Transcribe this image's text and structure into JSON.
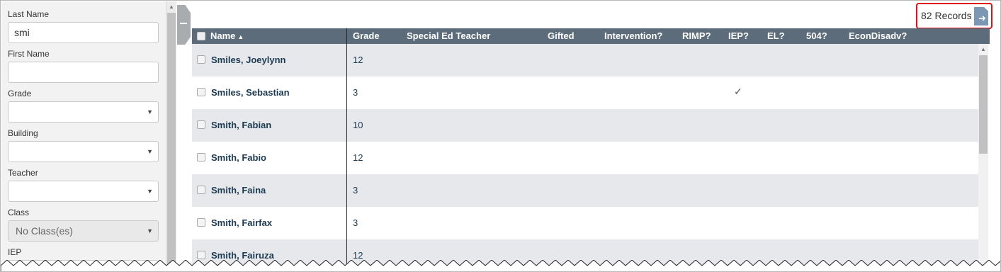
{
  "sidebar": {
    "last_name": {
      "label": "Last Name",
      "value": "smi"
    },
    "first_name": {
      "label": "First Name",
      "value": ""
    },
    "grade": {
      "label": "Grade",
      "value": ""
    },
    "building": {
      "label": "Building",
      "value": ""
    },
    "teacher": {
      "label": "Teacher",
      "value": ""
    },
    "class": {
      "label": "Class",
      "value": "No Class(es)"
    },
    "iep": {
      "label": "IEP"
    }
  },
  "records": {
    "count_label": "82 Records",
    "export_icon": "export-icon"
  },
  "table": {
    "columns": [
      {
        "label": "Name",
        "sort": "ascending"
      },
      {
        "label": "Grade"
      },
      {
        "label": "Special Ed Teacher"
      },
      {
        "label": "Gifted"
      },
      {
        "label": "Intervention?"
      },
      {
        "label": "RIMP?"
      },
      {
        "label": "IEP?"
      },
      {
        "label": "EL?"
      },
      {
        "label": "504?"
      },
      {
        "label": "EconDisadv?"
      }
    ],
    "sort_glyph": "▲",
    "check_glyph": "✓",
    "rows": [
      {
        "name": "Smiles, Joeylynn",
        "grade": "12",
        "iep": false
      },
      {
        "name": "Smiles, Sebastian",
        "grade": "3",
        "iep": true
      },
      {
        "name": "Smith, Fabian",
        "grade": "10",
        "iep": false
      },
      {
        "name": "Smith, Fabio",
        "grade": "12",
        "iep": false
      },
      {
        "name": "Smith, Faina",
        "grade": "3",
        "iep": false
      },
      {
        "name": "Smith, Fairfax",
        "grade": "3",
        "iep": false
      },
      {
        "name": "Smith, Fairuza",
        "grade": "12",
        "iep": false
      }
    ]
  },
  "colors": {
    "header_bg": "#5c6c7a",
    "row_shade": "#e6e8eb",
    "records_highlight": "#e0101b",
    "name_text": "#1c3a52"
  }
}
